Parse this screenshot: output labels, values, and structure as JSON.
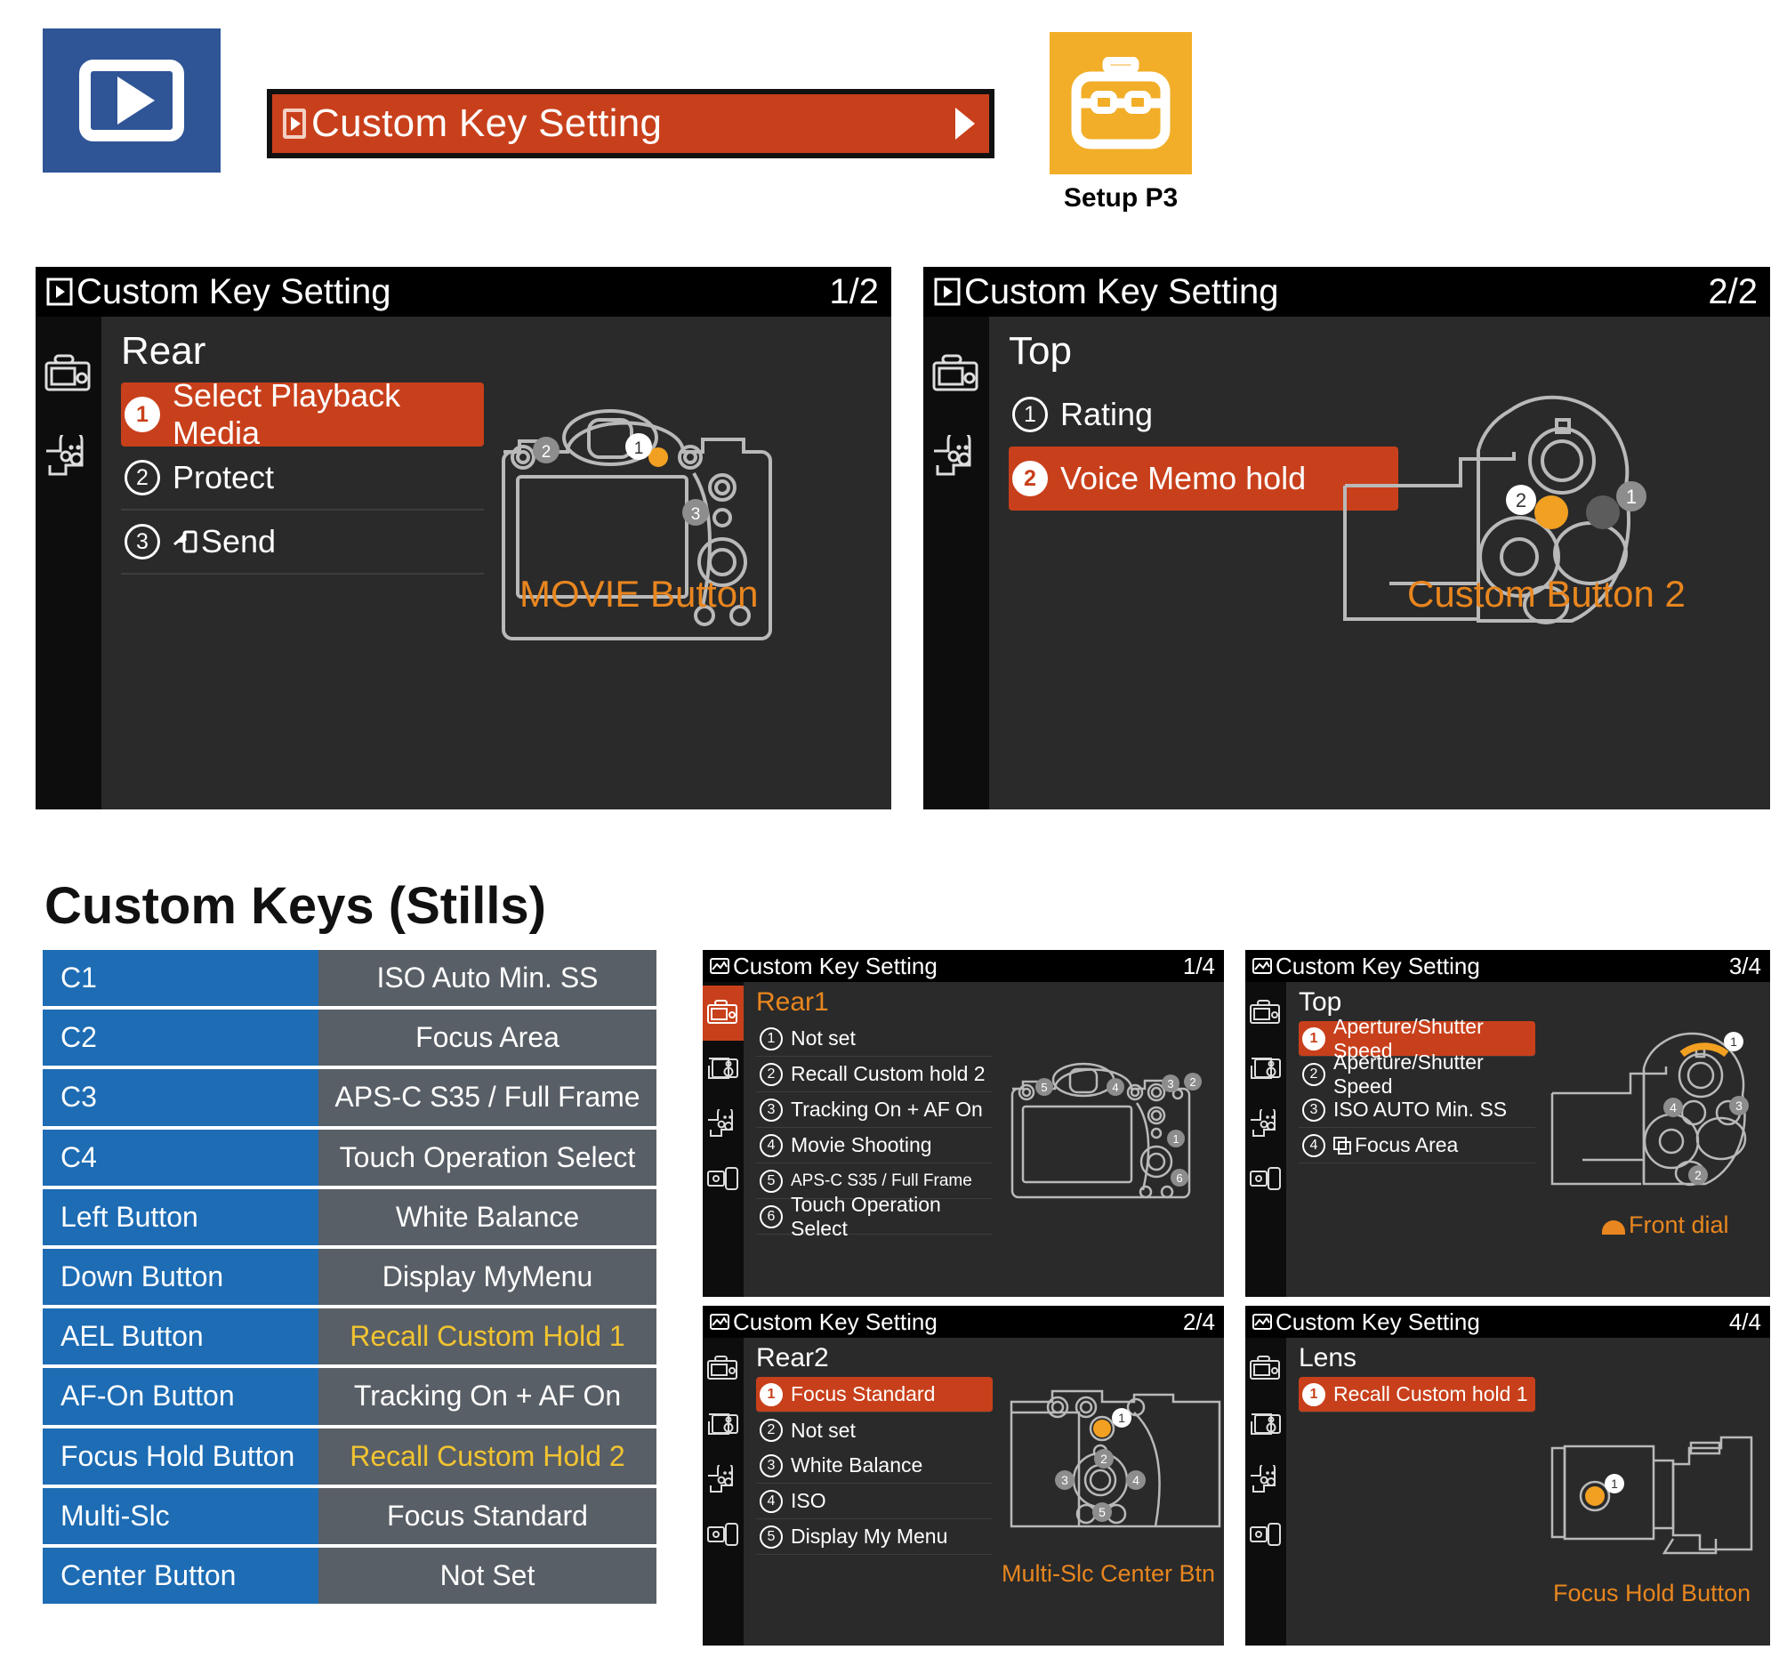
{
  "top": {
    "playback_badge_icon": "playback-icon",
    "menu_item": {
      "icon": "playback-icon",
      "label": "Custom Key Setting",
      "chevron": "chevron-right-icon"
    },
    "setup": {
      "icon": "toolbox-icon",
      "caption": "Setup P3"
    }
  },
  "screens": [
    {
      "title": "Custom Key Setting",
      "title_icon": "playback-icon",
      "page": "1/2",
      "group": "Rear",
      "rows": [
        {
          "n": "1",
          "label": "Select Playback Media",
          "selected": true
        },
        {
          "n": "2",
          "label": "Protect",
          "selected": false
        },
        {
          "n": "3",
          "label": "Send",
          "icon": "send-icon",
          "selected": false
        }
      ],
      "callout": "MOVIE Button",
      "diagram": "camera-rear-view"
    },
    {
      "title": "Custom Key Setting",
      "title_icon": "playback-icon",
      "page": "2/2",
      "group": "Top",
      "rows": [
        {
          "n": "1",
          "label": "Rating",
          "selected": false
        },
        {
          "n": "2",
          "label": "Voice Memo hold",
          "selected": true
        }
      ],
      "callout": "Custom Button 2",
      "diagram": "camera-top-view"
    }
  ],
  "section": {
    "title": "Custom Keys (Stills)"
  },
  "key_table": {
    "rows": [
      {
        "key": "C1",
        "value": "ISO Auto Min. SS",
        "highlight": false
      },
      {
        "key": "C2",
        "value": "Focus Area",
        "highlight": false
      },
      {
        "key": "C3",
        "value": "APS-C S35 / Full Frame",
        "highlight": false
      },
      {
        "key": "C4",
        "value": "Touch Operation Select",
        "highlight": false
      },
      {
        "key": "Left Button",
        "value": "White Balance",
        "highlight": false
      },
      {
        "key": "Down Button",
        "value": "Display MyMenu",
        "highlight": false
      },
      {
        "key": "AEL Button",
        "value": "Recall Custom Hold 1",
        "highlight": true
      },
      {
        "key": "AF-On Button",
        "value": "Tracking On + AF On",
        "highlight": false
      },
      {
        "key": "Focus Hold Button",
        "value": "Recall Custom Hold 2",
        "highlight": true
      },
      {
        "key": "Multi-Slc",
        "value": "Focus Standard",
        "highlight": false
      },
      {
        "key": "Center Button",
        "value": "Not Set",
        "highlight": false
      }
    ]
  },
  "small_screens": [
    {
      "title": "Custom Key Setting",
      "title_icon": "stills-icon",
      "page": "1/4",
      "group": "Rear1",
      "group_orange": true,
      "rail_active_index": 0,
      "rows": [
        {
          "n": "1",
          "label": "Not set",
          "selected": false
        },
        {
          "n": "2",
          "label": "Recall Custom hold 2",
          "selected": false
        },
        {
          "n": "3",
          "label": "Tracking On + AF On",
          "selected": false
        },
        {
          "n": "4",
          "label": "Movie Shooting",
          "selected": false
        },
        {
          "n": "5",
          "label": "APS-C S35 / Full Frame",
          "selected": false,
          "tight": true
        },
        {
          "n": "6",
          "label": "Touch Operation Select",
          "selected": false
        }
      ],
      "callout": "",
      "diagram": "camera-rear-view"
    },
    {
      "title": "Custom Key Setting",
      "title_icon": "stills-icon",
      "page": "3/4",
      "group": "Top",
      "group_orange": false,
      "rail_active_index": -1,
      "rows": [
        {
          "n": "1",
          "label": "Aperture/Shutter Speed",
          "selected": true
        },
        {
          "n": "2",
          "label": "Aperture/Shutter Speed",
          "selected": false
        },
        {
          "n": "3",
          "label": "ISO AUTO Min. SS",
          "selected": false
        },
        {
          "n": "4",
          "label": "Focus Area",
          "icon": "focus-area-icon",
          "selected": false
        }
      ],
      "callout": "Front dial",
      "callout_icon": "front-dial-icon",
      "diagram": "camera-top-view"
    },
    {
      "title": "Custom Key Setting",
      "title_icon": "stills-icon",
      "page": "2/4",
      "group": "Rear2",
      "group_orange": false,
      "rail_active_index": -1,
      "rows": [
        {
          "n": "1",
          "label": "Focus Standard",
          "selected": true
        },
        {
          "n": "2",
          "label": "Not set",
          "selected": false
        },
        {
          "n": "3",
          "label": "White Balance",
          "selected": false
        },
        {
          "n": "4",
          "label": "ISO",
          "selected": false
        },
        {
          "n": "5",
          "label": "Display My Menu",
          "selected": false
        }
      ],
      "callout": "Multi-Slc Center Btn",
      "diagram": "camera-back-view"
    },
    {
      "title": "Custom Key Setting",
      "title_icon": "stills-icon",
      "page": "4/4",
      "group": "Lens",
      "group_orange": false,
      "rail_active_index": -1,
      "rows": [
        {
          "n": "1",
          "label": "Recall Custom hold 1",
          "selected": true
        }
      ],
      "callout": "Focus Hold Button",
      "diagram": "camera-lens-side-view"
    }
  ],
  "colors": {
    "accent_orange": "#c8401b",
    "label_orange": "#e8861f",
    "blue_key": "#1d6cb4",
    "grey_value": "#595f66",
    "badge_blue": "#2f5597",
    "setup_yellow": "#f2ae28",
    "table_highlight": "#f2c431"
  }
}
